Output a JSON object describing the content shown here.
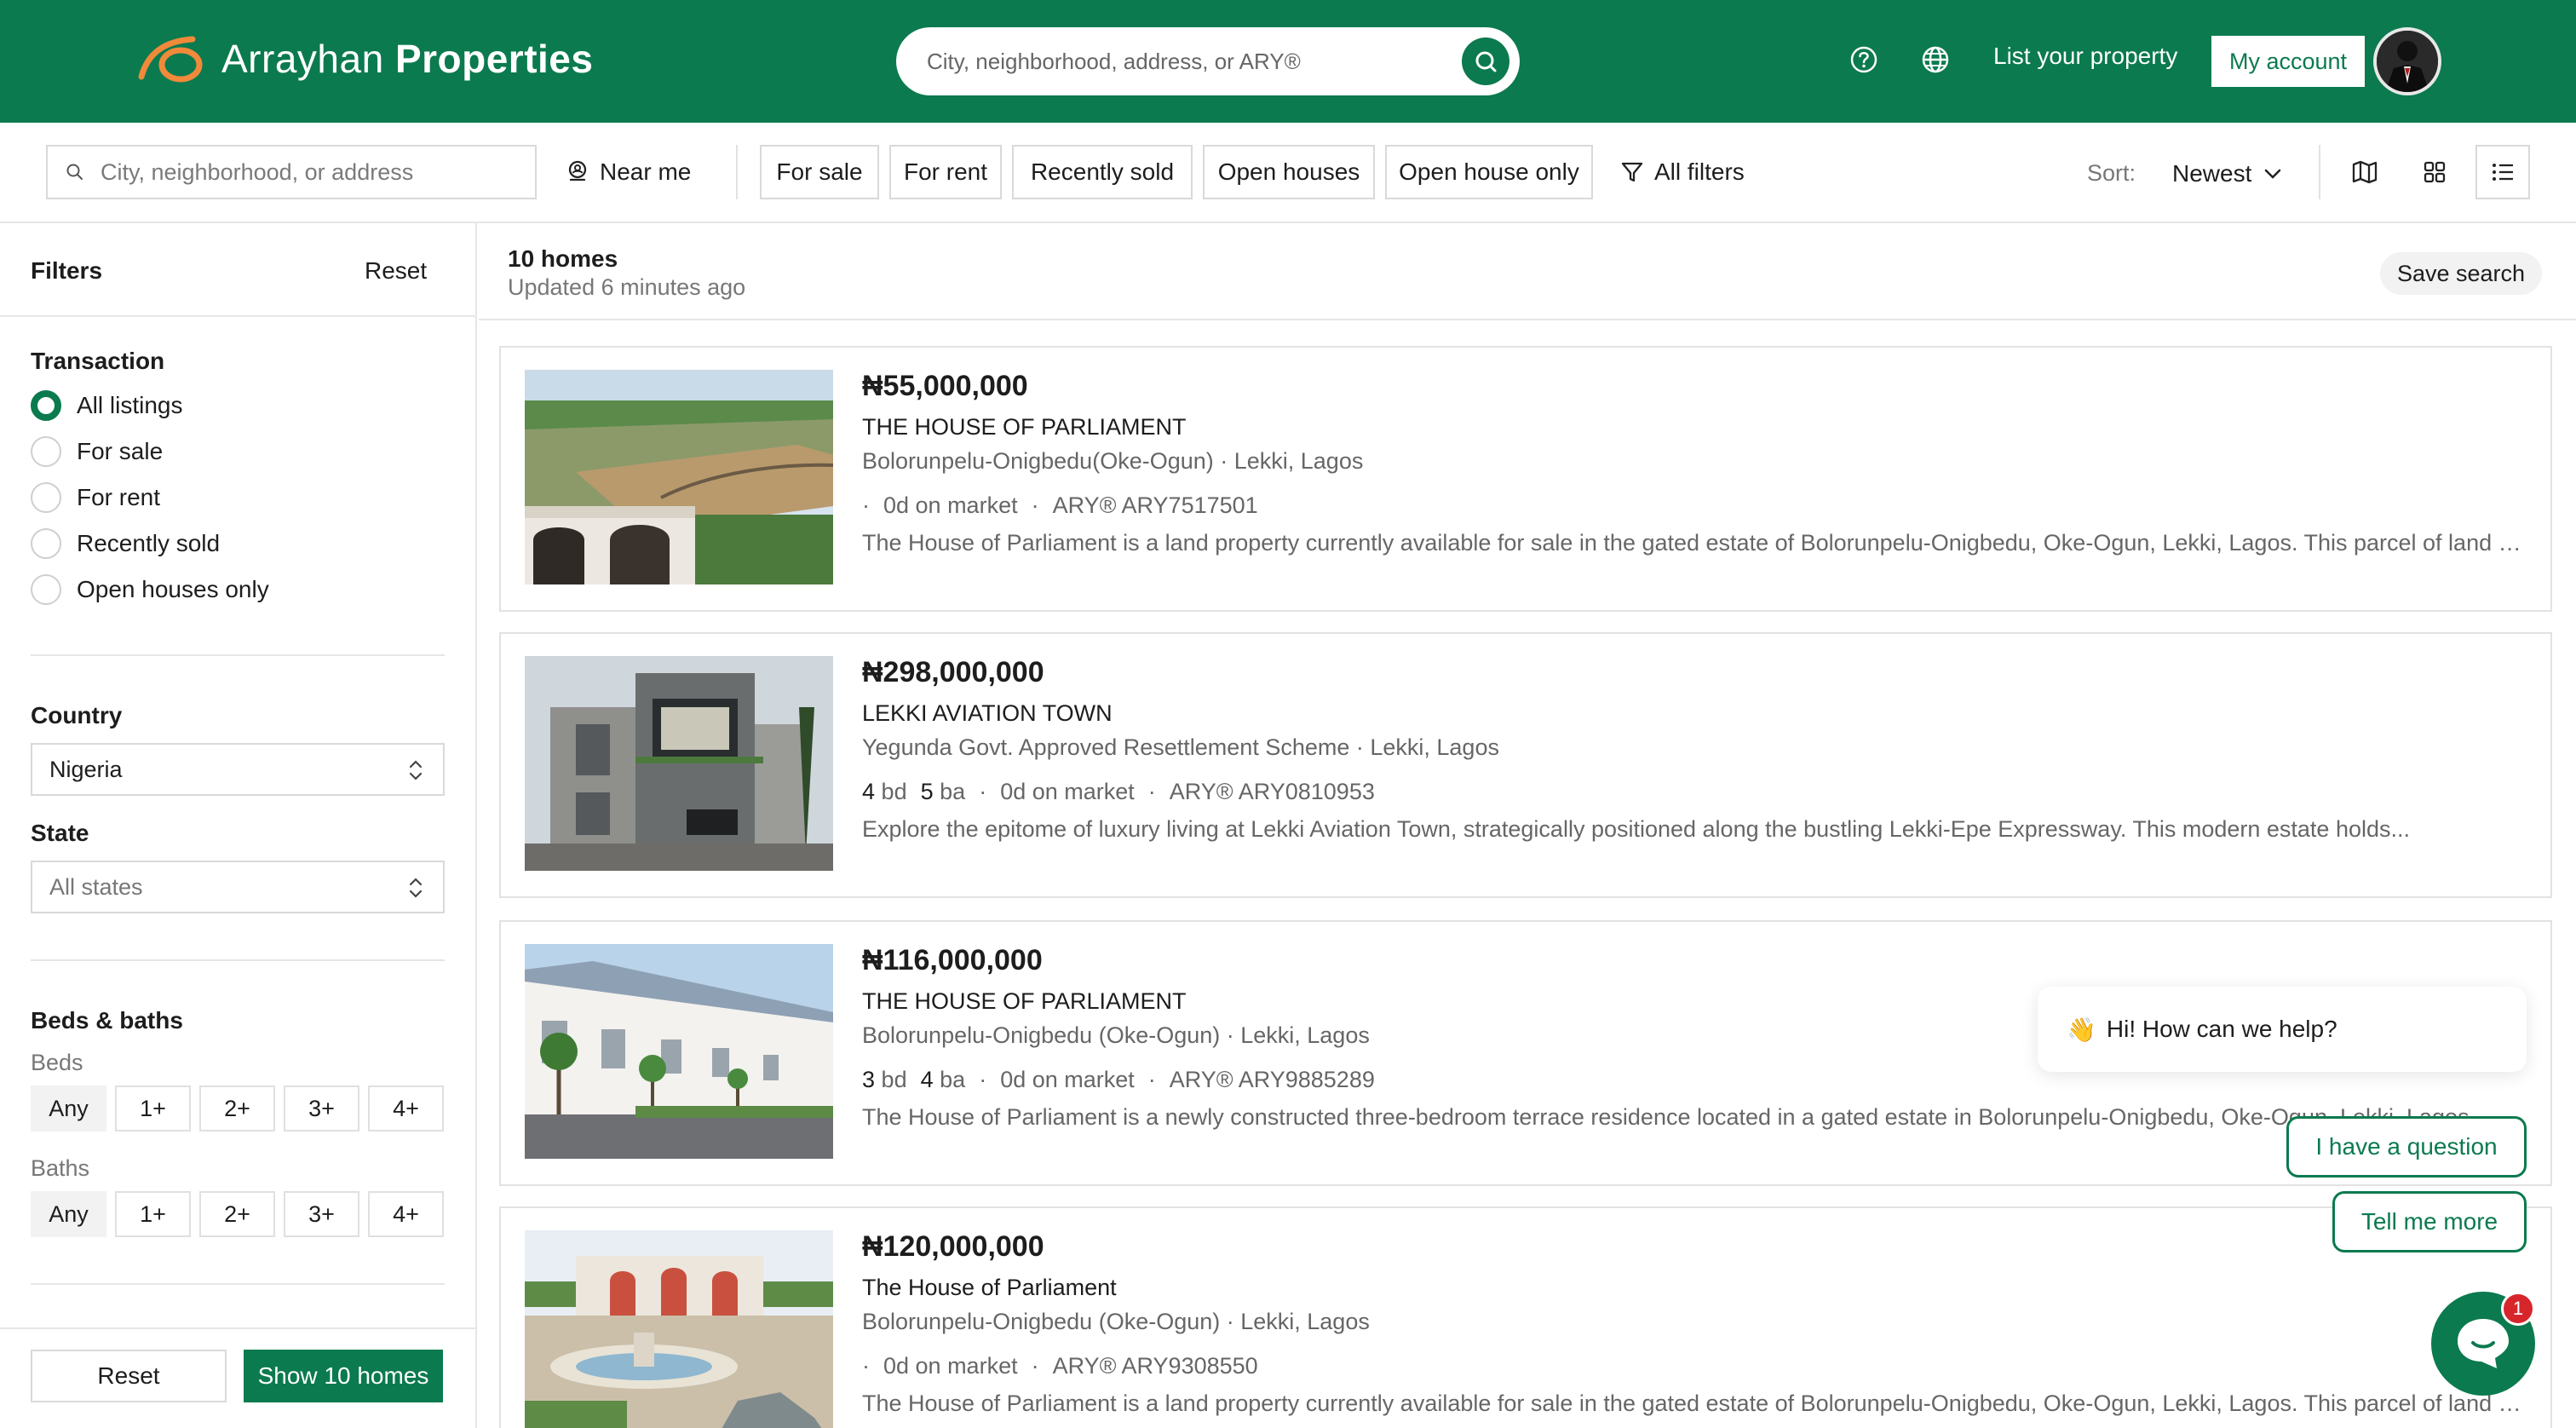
{
  "header": {
    "brand_light": "Arrayhan",
    "brand_bold": "Properties",
    "search_placeholder": "City, neighborhood, address, or ARY®",
    "list_property": "List your property",
    "my_account": "My account"
  },
  "filterbar": {
    "search_placeholder": "City, neighborhood, or address",
    "near_me": "Near me",
    "chips": [
      "For sale",
      "For rent",
      "Recently sold",
      "Open houses",
      "Open house only"
    ],
    "all_filters": "All filters",
    "sort_label": "Sort:",
    "sort_value": "Newest"
  },
  "sidebar": {
    "title": "Filters",
    "reset": "Reset",
    "transaction_title": "Transaction",
    "transaction_options": [
      "All listings",
      "For sale",
      "For rent",
      "Recently sold",
      "Open houses only"
    ],
    "transaction_selected": 0,
    "country_title": "Country",
    "country_value": "Nigeria",
    "state_title": "State",
    "state_value": "All states",
    "beds_baths_title": "Beds & baths",
    "beds_label": "Beds",
    "baths_label": "Baths",
    "options": [
      "Any",
      "1+",
      "2+",
      "3+",
      "4+"
    ],
    "footer_reset": "Reset",
    "footer_show": "Show 10 homes"
  },
  "results": {
    "count": "10 homes",
    "updated": "Updated 6 minutes ago",
    "save_search": "Save search",
    "listings": [
      {
        "price": "₦55,000,000",
        "title": "THE HOUSE OF PARLIAMENT",
        "location": "Bolorunpelu-Onigbedu(Oke-Ogun) · Lekki, Lagos",
        "beds": "",
        "baths": "",
        "market": "0d on market",
        "ary": "ARY® ARY7517501",
        "description": "The House of Parliament is a land property currently available for sale in the gated estate of Bolorunpelu-Onigbedu, Oke-Ogun, Lekki, Lagos. This parcel of land offers an excellent opportunity"
      },
      {
        "price": "₦298,000,000",
        "title": "LEKKI AVIATION TOWN",
        "location": "Yegunda Govt. Approved Resettlement Scheme · Lekki, Lagos",
        "beds": "4",
        "baths": "5",
        "market": "0d on market",
        "ary": "ARY® ARY0810953",
        "description": "Explore the epitome of luxury living at Lekki Aviation Town, strategically positioned along the bustling Lekki-Epe Expressway. This modern estate holds..."
      },
      {
        "price": "₦116,000,000",
        "title": "THE HOUSE OF PARLIAMENT",
        "location": "Bolorunpelu-Onigbedu (Oke-Ogun) · Lekki, Lagos",
        "beds": "3",
        "baths": "4",
        "market": "0d on market",
        "ary": "ARY® ARY9885289",
        "description": "The House of Parliament is a newly constructed three-bedroom terrace residence located in a gated estate in Bolorunpelu-Onigbedu, Oke-Ogun, Lekki, Lagos"
      },
      {
        "price": "₦120,000,000",
        "title": "The House of Parliament",
        "location": "Bolorunpelu-Onigbedu (Oke-Ogun) · Lekki, Lagos",
        "beds": "",
        "baths": "",
        "market": "0d on market",
        "ary": "ARY® ARY9308550",
        "description": "The House of Parliament is a land property currently available for sale in the gated estate of Bolorunpelu-Onigbedu, Oke-Ogun, Lekki, Lagos. This parcel of land offers an excellent opportunity"
      }
    ],
    "bd_unit": "bd",
    "ba_unit": "ba"
  },
  "chat": {
    "greeting": "Hi! How can we help?",
    "greeting_emoji": "👋",
    "question": "I have a question",
    "tell_more": "Tell me more",
    "badge": "1"
  },
  "colors": {
    "brand": "#0b7a4f",
    "badge": "#d6262b"
  }
}
